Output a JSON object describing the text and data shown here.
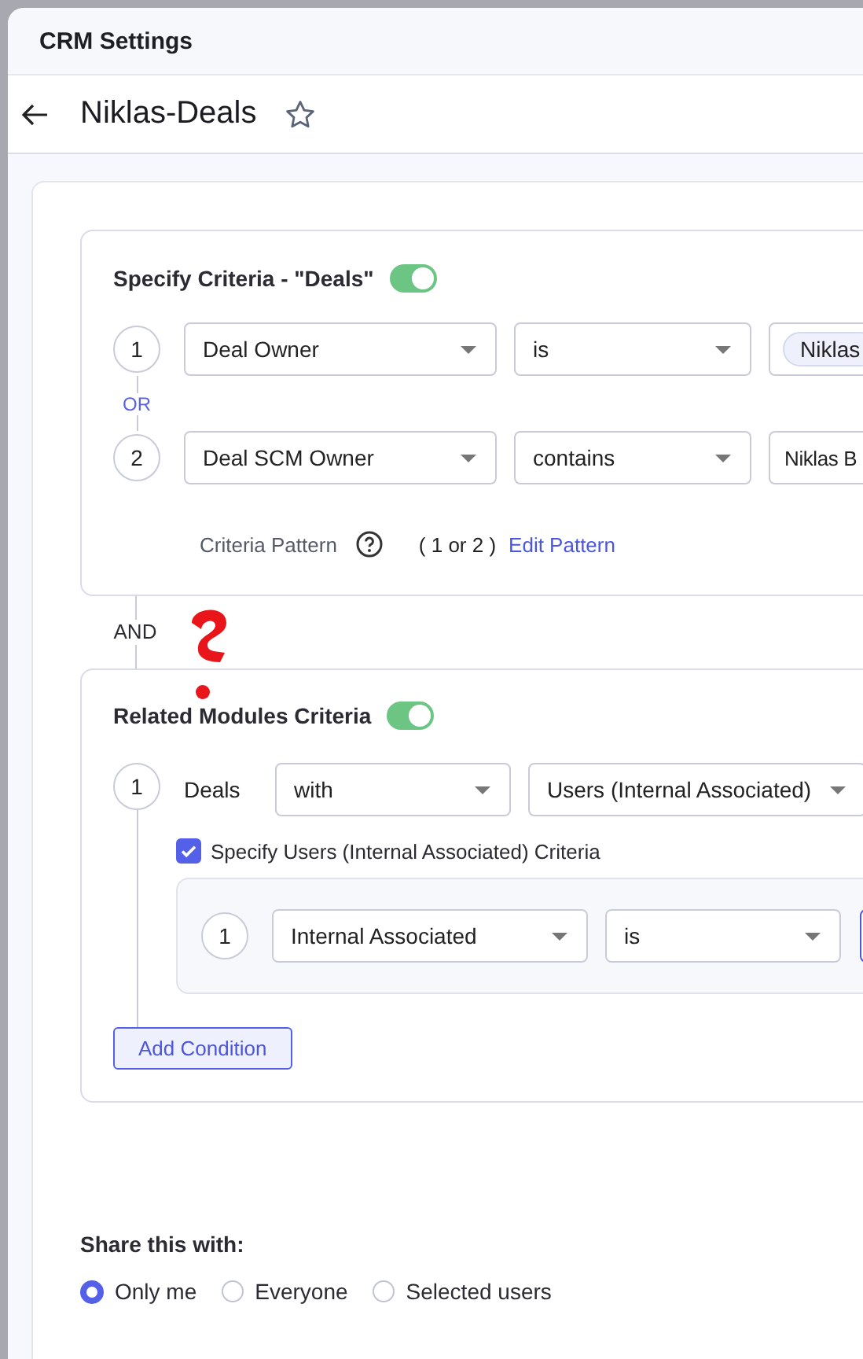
{
  "header": {
    "title": "CRM Settings"
  },
  "page": {
    "title": "Niklas-Deals",
    "favorite": false
  },
  "criteria": {
    "title": "Specify Criteria - \"Deals\"",
    "enabled": true,
    "conditions": [
      {
        "number": "1",
        "field": "Deal Owner",
        "operator": "is",
        "value": "Niklas",
        "kind": "chip"
      },
      {
        "number": "2",
        "field": "Deal SCM Owner",
        "operator": "contains",
        "value": "Niklas B",
        "kind": "text"
      }
    ],
    "connectors": [
      "OR"
    ],
    "pattern_label": "Criteria Pattern",
    "pattern": "( 1 or 2 )",
    "edit_link": "Edit Pattern"
  },
  "join": "AND",
  "annotation": {
    "kind": "question-mark"
  },
  "related": {
    "title": "Related Modules Criteria",
    "enabled": true,
    "conditions": [
      {
        "number": "1",
        "module": "Deals",
        "relation": "with",
        "target": "Users (Internal Associated)",
        "sub_criteria": {
          "label": "Specify Users (Internal Associated) Criteria",
          "checked": true,
          "conditions": [
            {
              "number": "1",
              "field": "Internal Associated",
              "operator": "is",
              "value_focused": true
            }
          ]
        }
      }
    ],
    "add_button": "Add Condition"
  },
  "share": {
    "label": "Share this with:",
    "options": [
      {
        "label": "Only me",
        "selected": true
      },
      {
        "label": "Everyone",
        "selected": false
      },
      {
        "label": "Selected users",
        "selected": false
      }
    ]
  }
}
